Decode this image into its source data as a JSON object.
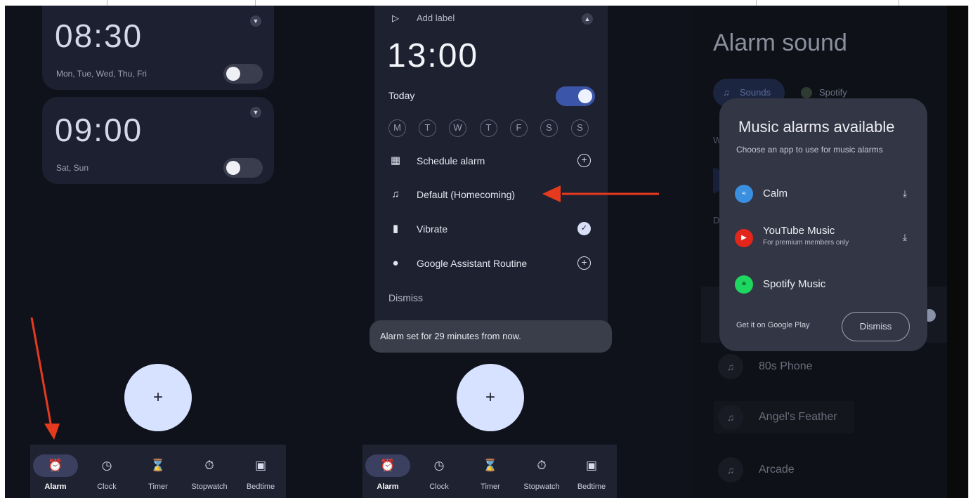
{
  "colors": {
    "annotation_arrow": "#e63a1e",
    "toggle_on": "#3b55a8",
    "fab": "#d6e2ff",
    "background": "#10121b"
  },
  "panel1": {
    "alarms": [
      {
        "time": "08:30",
        "days": "Mon, Tue, Wed, Thu, Fri",
        "enabled": false
      },
      {
        "time": "09:00",
        "days": "Sat, Sun",
        "enabled": false
      }
    ],
    "fab_label": "+"
  },
  "panel2": {
    "add_label": "Add label",
    "time": "13:00",
    "today_label": "Today",
    "today_enabled": true,
    "weekdays": [
      "M",
      "T",
      "W",
      "T",
      "F",
      "S",
      "S"
    ],
    "rows": {
      "schedule": "Schedule alarm",
      "sound": "Default (Homecoming)",
      "vibrate": "Vibrate",
      "assistant": "Google Assistant Routine",
      "dismiss": "Dismiss"
    },
    "snackbar": "Alarm set for 29 minutes from now.",
    "fab_label": "+"
  },
  "nav": {
    "items": [
      {
        "label": "Alarm",
        "icon": "alarm-icon"
      },
      {
        "label": "Clock",
        "icon": "clock-icon"
      },
      {
        "label": "Timer",
        "icon": "hourglass-icon"
      },
      {
        "label": "Stopwatch",
        "icon": "stopwatch-icon"
      },
      {
        "label": "Bedtime",
        "icon": "bed-icon"
      }
    ],
    "active": "Alarm"
  },
  "panel3": {
    "title": "Alarm sound",
    "tabs": [
      "Sounds",
      "Spotify"
    ],
    "section_letter_1": "W",
    "section_letter_2": "D",
    "sounds": [
      "80s Phone",
      "Angel's Feather",
      "Arcade"
    ],
    "dialog": {
      "title": "Music alarms available",
      "subtitle": "Choose an app to use for music alarms",
      "apps": [
        {
          "name": "Calm",
          "note": "",
          "icon_color": "#3b8fe0",
          "download": true
        },
        {
          "name": "YouTube Music",
          "note": "For premium members only",
          "icon_color": "#e3261c",
          "download": true
        },
        {
          "name": "Spotify Music",
          "note": "",
          "icon_color": "#1ed760",
          "download": false
        }
      ],
      "play_link": "Get it on Google Play",
      "dismiss": "Dismiss"
    }
  }
}
